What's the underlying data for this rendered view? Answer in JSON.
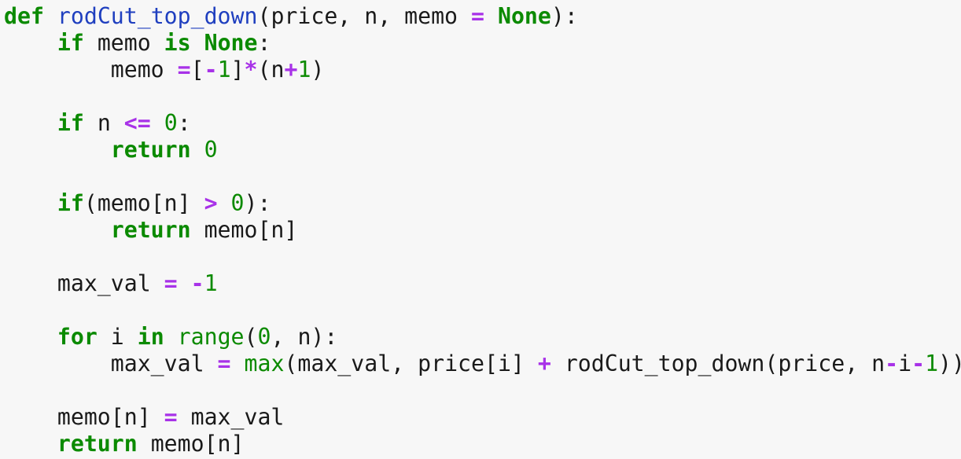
{
  "editor": {
    "language": "python",
    "lines": [
      [
        {
          "t": "def",
          "k": "kw"
        },
        {
          "t": " ",
          "k": "ws"
        },
        {
          "t": "rodCut_top_down",
          "k": "fn"
        },
        {
          "t": "(price, n, memo ",
          "k": "punc"
        },
        {
          "t": "=",
          "k": "op"
        },
        {
          "t": " ",
          "k": "ws"
        },
        {
          "t": "None",
          "k": "kw"
        },
        {
          "t": "):",
          "k": "punc"
        }
      ],
      [
        {
          "t": "    ",
          "k": "ws"
        },
        {
          "t": "if",
          "k": "kw"
        },
        {
          "t": " memo ",
          "k": "ident"
        },
        {
          "t": "is",
          "k": "kw"
        },
        {
          "t": " ",
          "k": "ws"
        },
        {
          "t": "None",
          "k": "kw"
        },
        {
          "t": ":",
          "k": "punc"
        }
      ],
      [
        {
          "t": "        ",
          "k": "ws"
        },
        {
          "t": "memo ",
          "k": "ident"
        },
        {
          "t": "=",
          "k": "op"
        },
        {
          "t": "[",
          "k": "punc"
        },
        {
          "t": "-",
          "k": "op"
        },
        {
          "t": "1",
          "k": "num"
        },
        {
          "t": "]",
          "k": "punc"
        },
        {
          "t": "*",
          "k": "op"
        },
        {
          "t": "(n",
          "k": "punc"
        },
        {
          "t": "+",
          "k": "op"
        },
        {
          "t": "1",
          "k": "num"
        },
        {
          "t": ")",
          "k": "punc"
        }
      ],
      [],
      [
        {
          "t": "    ",
          "k": "ws"
        },
        {
          "t": "if",
          "k": "kw"
        },
        {
          "t": " n ",
          "k": "ident"
        },
        {
          "t": "<=",
          "k": "op"
        },
        {
          "t": " ",
          "k": "ws"
        },
        {
          "t": "0",
          "k": "num"
        },
        {
          "t": ":",
          "k": "punc"
        }
      ],
      [
        {
          "t": "        ",
          "k": "ws"
        },
        {
          "t": "return",
          "k": "kw"
        },
        {
          "t": " ",
          "k": "ws"
        },
        {
          "t": "0",
          "k": "num"
        }
      ],
      [],
      [
        {
          "t": "    ",
          "k": "ws"
        },
        {
          "t": "if",
          "k": "kw"
        },
        {
          "t": "(memo[n] ",
          "k": "punc"
        },
        {
          "t": ">",
          "k": "op"
        },
        {
          "t": " ",
          "k": "ws"
        },
        {
          "t": "0",
          "k": "num"
        },
        {
          "t": "):",
          "k": "punc"
        }
      ],
      [
        {
          "t": "        ",
          "k": "ws"
        },
        {
          "t": "return",
          "k": "kw"
        },
        {
          "t": " memo[n]",
          "k": "ident"
        }
      ],
      [],
      [
        {
          "t": "    ",
          "k": "ws"
        },
        {
          "t": "max_val ",
          "k": "ident"
        },
        {
          "t": "=",
          "k": "op"
        },
        {
          "t": " ",
          "k": "ws"
        },
        {
          "t": "-",
          "k": "op"
        },
        {
          "t": "1",
          "k": "num"
        }
      ],
      [],
      [
        {
          "t": "    ",
          "k": "ws"
        },
        {
          "t": "for",
          "k": "kw"
        },
        {
          "t": " i ",
          "k": "ident"
        },
        {
          "t": "in",
          "k": "kw"
        },
        {
          "t": " ",
          "k": "ws"
        },
        {
          "t": "range",
          "k": "builtin"
        },
        {
          "t": "(",
          "k": "punc"
        },
        {
          "t": "0",
          "k": "num"
        },
        {
          "t": ", n):",
          "k": "punc"
        }
      ],
      [
        {
          "t": "        ",
          "k": "ws"
        },
        {
          "t": "max_val ",
          "k": "ident"
        },
        {
          "t": "=",
          "k": "op"
        },
        {
          "t": " ",
          "k": "ws"
        },
        {
          "t": "max",
          "k": "builtin"
        },
        {
          "t": "(max_val, price[i] ",
          "k": "punc"
        },
        {
          "t": "+",
          "k": "op"
        },
        {
          "t": " rodCut_top_down(price, n",
          "k": "ident"
        },
        {
          "t": "-",
          "k": "op"
        },
        {
          "t": "i",
          "k": "ident"
        },
        {
          "t": "-",
          "k": "op"
        },
        {
          "t": "1",
          "k": "num"
        },
        {
          "t": "))",
          "k": "punc"
        }
      ],
      [],
      [
        {
          "t": "    ",
          "k": "ws"
        },
        {
          "t": "memo[n] ",
          "k": "ident"
        },
        {
          "t": "=",
          "k": "op"
        },
        {
          "t": " max_val",
          "k": "ident"
        }
      ],
      [
        {
          "t": "    ",
          "k": "ws"
        },
        {
          "t": "return",
          "k": "kw"
        },
        {
          "t": " memo[n]",
          "k": "ident"
        }
      ]
    ]
  },
  "colors": {
    "background": "#f7f7f7",
    "keyword": "#0b8a00",
    "function_name": "#1f3fbf",
    "operator": "#a832e8",
    "number": "#0b8a00",
    "text": "#1a1a1a"
  }
}
